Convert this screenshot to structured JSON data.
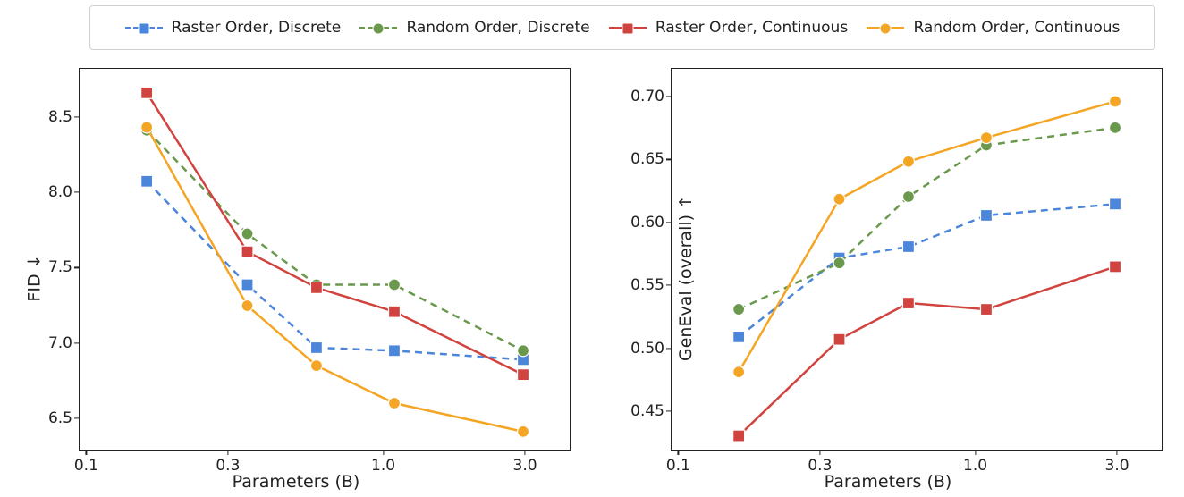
{
  "legend": [
    {
      "name": "raster-discrete",
      "label": "Raster Order, Discrete",
      "color": "#4b86db",
      "marker": "square",
      "style": "dashed"
    },
    {
      "name": "random-discrete",
      "label": "Random Order, Discrete",
      "color": "#6a994e",
      "marker": "circle",
      "style": "dashed"
    },
    {
      "name": "raster-continuous",
      "label": "Raster Order, Continuous",
      "color": "#d1433f",
      "marker": "square",
      "style": "solid"
    },
    {
      "name": "random-continuous",
      "label": "Random Order, Continuous",
      "color": "#f4a524",
      "marker": "circle",
      "style": "solid"
    }
  ],
  "xlabel": "Parameters (B)",
  "left": {
    "ylabel": "FID ↓",
    "xticks": [
      0.1,
      0.3,
      1.0,
      3.0
    ],
    "yticks": [
      6.5,
      7.0,
      7.5,
      8.0,
      8.5
    ],
    "xlim": [
      0.095,
      4.3
    ],
    "ylim": [
      6.28,
      8.82
    ]
  },
  "right": {
    "ylabel": "GenEval (overall) ↑",
    "xticks": [
      0.1,
      0.3,
      1.0,
      3.0
    ],
    "yticks": [
      0.45,
      0.5,
      0.55,
      0.6,
      0.65,
      0.7
    ],
    "xlim": [
      0.095,
      4.3
    ],
    "ylim": [
      0.418,
      0.722
    ]
  },
  "chart_data": [
    {
      "type": "line",
      "title": "",
      "xlabel": "Parameters (B)",
      "ylabel": "FID ↓",
      "xscale": "log",
      "xlim": [
        0.095,
        4.3
      ],
      "ylim": [
        6.28,
        8.82
      ],
      "x": [
        0.16,
        0.35,
        0.6,
        1.1,
        3.0
      ],
      "series": [
        {
          "name": "Raster Order, Discrete",
          "color": "#4b86db",
          "marker": "square",
          "style": "dashed",
          "values": [
            8.07,
            7.38,
            6.96,
            6.94,
            6.88
          ]
        },
        {
          "name": "Random Order, Discrete",
          "color": "#6a994e",
          "marker": "circle",
          "style": "dashed",
          "values": [
            8.41,
            7.72,
            7.38,
            7.38,
            6.94
          ]
        },
        {
          "name": "Raster Order, Continuous",
          "color": "#d1433f",
          "marker": "square",
          "style": "solid",
          "values": [
            8.66,
            7.6,
            7.36,
            7.2,
            6.78
          ]
        },
        {
          "name": "Random Order, Continuous",
          "color": "#f4a524",
          "marker": "circle",
          "style": "solid",
          "values": [
            8.43,
            7.24,
            6.84,
            6.59,
            6.4
          ]
        }
      ]
    },
    {
      "type": "line",
      "title": "",
      "xlabel": "Parameters (B)",
      "ylabel": "GenEval (overall) ↑",
      "xscale": "log",
      "xlim": [
        0.095,
        4.3
      ],
      "ylim": [
        0.418,
        0.722
      ],
      "x": [
        0.16,
        0.35,
        0.6,
        1.1,
        3.0
      ],
      "series": [
        {
          "name": "Raster Order, Discrete",
          "color": "#4b86db",
          "marker": "square",
          "style": "dashed",
          "values": [
            0.508,
            0.571,
            0.58,
            0.605,
            0.614
          ]
        },
        {
          "name": "Random Order, Discrete",
          "color": "#6a994e",
          "marker": "circle",
          "style": "dashed",
          "values": [
            0.53,
            0.567,
            0.62,
            0.661,
            0.675
          ]
        },
        {
          "name": "Raster Order, Continuous",
          "color": "#d1433f",
          "marker": "square",
          "style": "solid",
          "values": [
            0.429,
            0.506,
            0.535,
            0.53,
            0.564
          ]
        },
        {
          "name": "Random Order, Continuous",
          "color": "#f4a524",
          "marker": "circle",
          "style": "solid",
          "values": [
            0.48,
            0.618,
            0.648,
            0.667,
            0.696
          ]
        }
      ]
    }
  ]
}
